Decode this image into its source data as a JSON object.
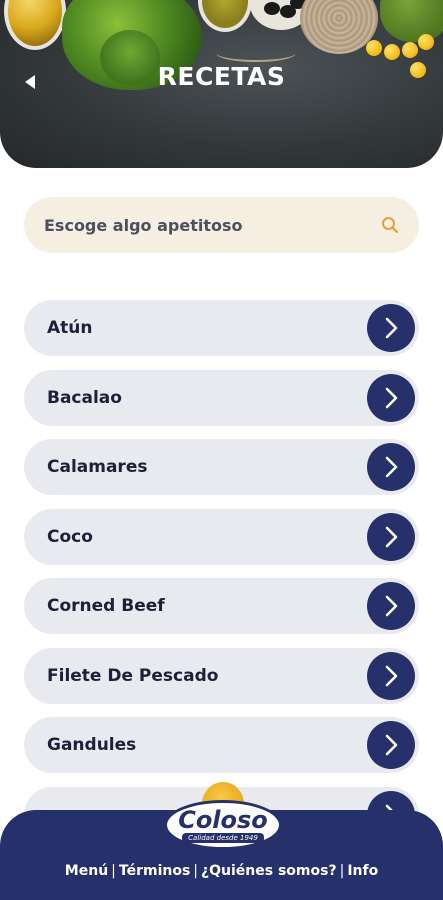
{
  "header": {
    "title": "RECETAS",
    "back_icon": "back-arrow-icon"
  },
  "search": {
    "placeholder": "Escoge algo apetitoso",
    "value": "",
    "icon": "search-icon",
    "icon_color": "#e0a23a"
  },
  "categories": [
    {
      "label": "Atún"
    },
    {
      "label": "Bacalao"
    },
    {
      "label": "Calamares"
    },
    {
      "label": "Coco"
    },
    {
      "label": "Corned Beef"
    },
    {
      "label": "Filete De Pescado"
    },
    {
      "label": "Gandules"
    }
  ],
  "footer": {
    "logo_brand": "Coloso",
    "logo_tagline": "Calidad desde 1949",
    "links": [
      "Menú",
      "Términos",
      "¿Quiénes somos?",
      "Info"
    ]
  },
  "colors": {
    "primary": "#26306b",
    "item_bg": "#e9eaef",
    "search_bg": "#f6efe1"
  }
}
